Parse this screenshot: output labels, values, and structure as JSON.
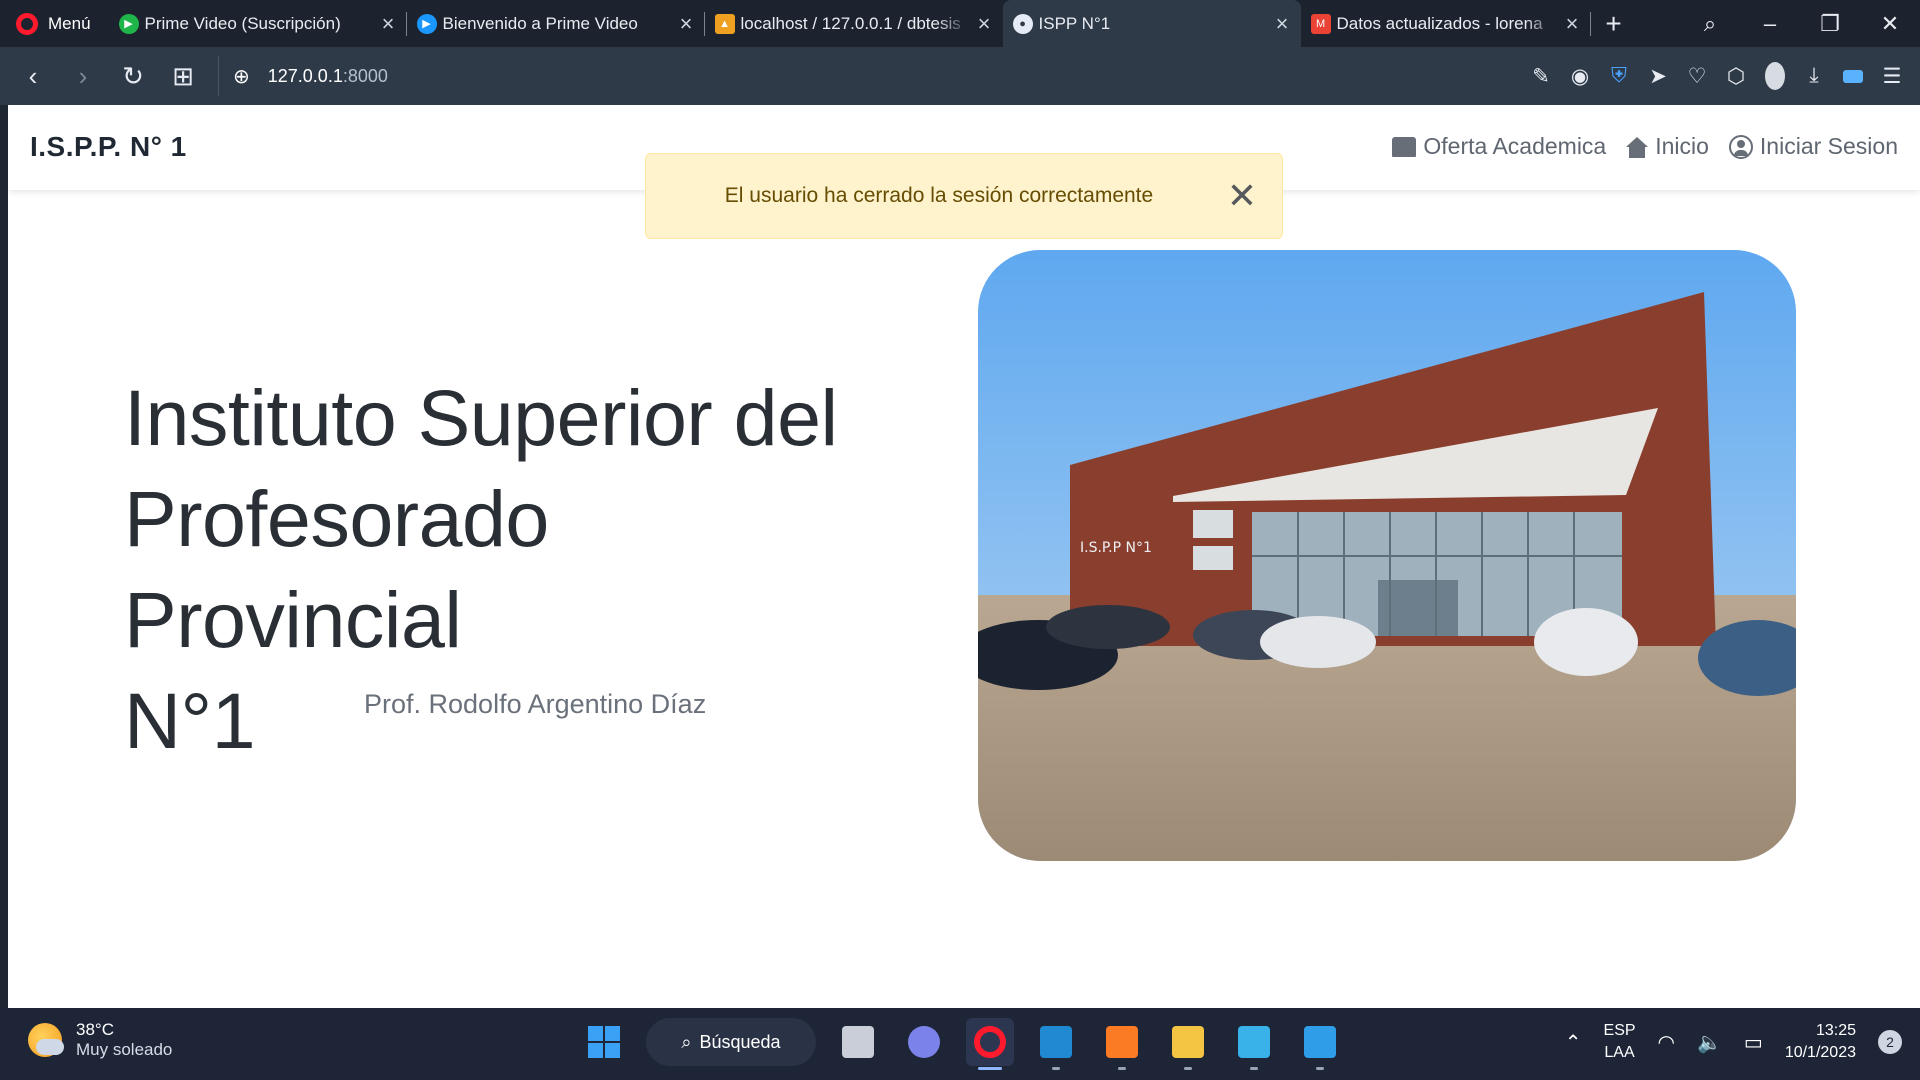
{
  "browser": {
    "menu_label": "Menú",
    "tabs": [
      {
        "label": "Prime Video (Suscripción)",
        "favicon": "play-circle-icon",
        "color": "#1eb54a"
      },
      {
        "label": "Bienvenido a Prime Video",
        "favicon": "prime-video-icon",
        "color": "#1a98ff"
      },
      {
        "label": "localhost / 127.0.0.1 / dbtesis",
        "favicon": "phpmyadmin-icon",
        "color": "#f0a020"
      },
      {
        "label": "ISPP N°1",
        "favicon": "site-icon",
        "color": "#e6ecf5",
        "active": true
      },
      {
        "label": "Datos actualizados - lorena",
        "favicon": "gmail-icon",
        "color": "#ea4335"
      }
    ],
    "url_host": "127.0.0.1",
    "url_port": ":8000"
  },
  "site": {
    "brand": "I.S.P.P. N° 1",
    "nav": [
      {
        "label": "Oferta Academica",
        "icon": "book-icon"
      },
      {
        "label": "Inicio",
        "icon": "home-icon"
      },
      {
        "label": "Iniciar Sesion",
        "icon": "user-circle-icon"
      }
    ],
    "alert": "El usuario ha cerrado la sesión correctamente",
    "hero_title_lines": [
      "Instituto Superior del",
      "Profesorado Provincial",
      "N°1"
    ],
    "hero_subtitle": "Prof. Rodolfo Argentino Díaz",
    "photo_sign": "I.S.P.P N°1"
  },
  "taskbar": {
    "weather_temp": "38°C",
    "weather_desc": "Muy soleado",
    "search_label": "Búsqueda",
    "lang_line1": "ESP",
    "lang_line2": "LAA",
    "time": "13:25",
    "date": "10/1/2023",
    "notifications": "2"
  }
}
